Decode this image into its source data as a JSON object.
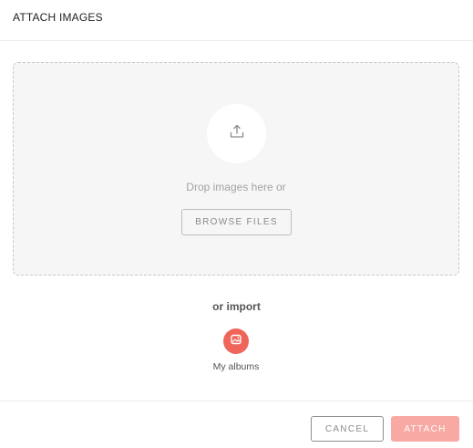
{
  "dialog": {
    "title": "ATTACH IMAGES"
  },
  "dropzone": {
    "icon": "upload-icon",
    "prompt": "Drop images here or",
    "browse_label": "BROWSE FILES"
  },
  "import": {
    "heading": "or import",
    "sources": [
      {
        "label": "My albums",
        "icon": "album-icon",
        "color": "#f0655a"
      }
    ]
  },
  "footer": {
    "cancel_label": "CANCEL",
    "attach_label": "ATTACH",
    "attach_color": "#f9a9a3"
  }
}
